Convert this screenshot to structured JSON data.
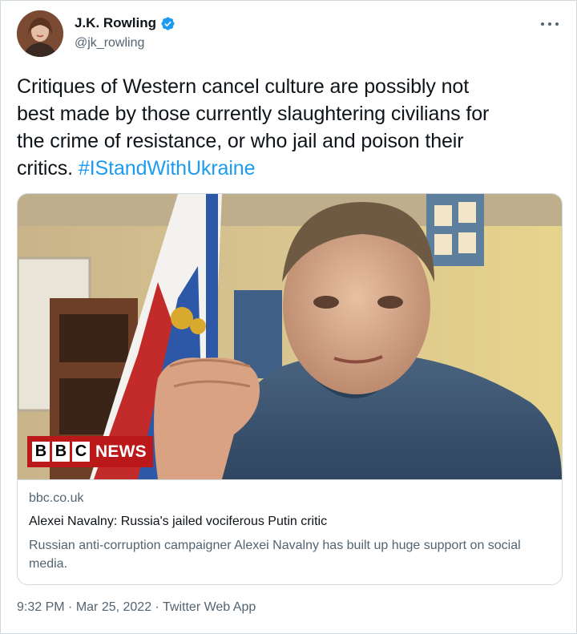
{
  "author": {
    "name": "J.K. Rowling",
    "handle": "@jk_rowling",
    "verified": true,
    "avatar_icon": "profile-photo"
  },
  "tweet": {
    "text_line1": "Critiques of Western cancel culture are possibly not",
    "text_line2": "best made by those currently slaughtering civilians for",
    "text_line3": "the crime of resistance, or who jail and poison their",
    "text_line4_prefix": "critics.",
    "hashtag": "#IStandWithUkraine"
  },
  "card": {
    "image_badge_letters": [
      "B",
      "B",
      "C"
    ],
    "image_badge_text": "NEWS",
    "domain": "bbc.co.uk",
    "title": "Alexei Navalny: Russia's jailed vociferous Putin critic",
    "description": "Russian anti-corruption campaigner Alexei Navalny has built up huge support on social media."
  },
  "footer": {
    "time": "9:32 PM",
    "separator": " · ",
    "date": "Mar 25, 2022",
    "source": "Twitter Web App"
  },
  "colors": {
    "link": "#1d9bf0",
    "secondary_text": "#536471",
    "border": "#cfd9de",
    "bbc_red": "#bb1919"
  }
}
